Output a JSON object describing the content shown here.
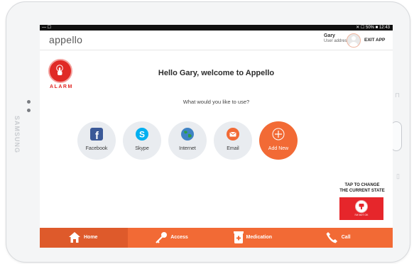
{
  "device": {
    "brand": "SAMSUNG"
  },
  "status_bar": {
    "left": "— ☐",
    "right": "✕ ☐ 50% ■ 12:43"
  },
  "header": {
    "logo": "appello",
    "user_name": "Gary",
    "user_subtitle": "User address",
    "exit_label": "EXIT APP"
  },
  "alarm": {
    "label": "ALARM",
    "color": "#e02a26"
  },
  "main": {
    "welcome": "Hello Gary, welcome to Appello",
    "question": "What would you like to use?",
    "apps": [
      {
        "label": "Facebook",
        "icon": "facebook-icon",
        "color": "#3b5998"
      },
      {
        "label": "Skype",
        "icon": "skype-icon",
        "color": "#00aff0"
      },
      {
        "label": "Internet",
        "icon": "globe-icon",
        "color": "#2e7d32"
      },
      {
        "label": "Email",
        "icon": "email-icon",
        "color": "#f26a35"
      },
      {
        "label": "Add New",
        "icon": "plus-icon",
        "color": "#f26a35"
      }
    ]
  },
  "state_panel": {
    "line1": "TAP TO CHANGE",
    "line2": "THE CURRENT STATE",
    "button_label": "I'M NOT OK",
    "color": "#e6262b"
  },
  "bottom_nav": {
    "items": [
      {
        "label": "Home",
        "icon": "home-icon",
        "active": true
      },
      {
        "label": "Access",
        "icon": "key-icon",
        "active": false
      },
      {
        "label": "Medication",
        "icon": "medication-icon",
        "active": false
      },
      {
        "label": "Call",
        "icon": "phone-icon",
        "active": false
      }
    ]
  },
  "colors": {
    "accent": "#f26a35",
    "accent_dark": "#de5a2b"
  }
}
